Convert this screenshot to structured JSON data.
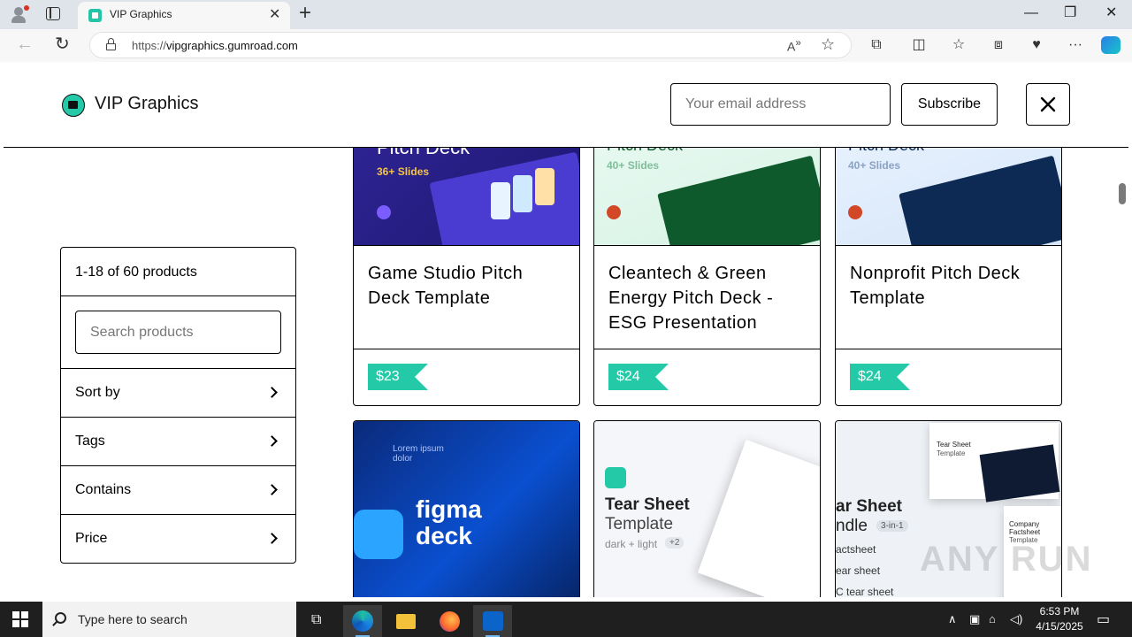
{
  "browser": {
    "tab_title": "VIP Graphics",
    "url_prefix": "https://",
    "url_host": "vipgraphics.gumroad.com"
  },
  "header": {
    "site_title": "VIP Graphics",
    "email_placeholder": "Your email address",
    "subscribe_label": "Subscribe"
  },
  "filters": {
    "count": "1-18 of 60 products",
    "search_placeholder": "Search products",
    "rows": [
      "Sort by",
      "Tags",
      "Contains",
      "Price"
    ]
  },
  "products": [
    {
      "title": "Game Studio Pitch Deck Template",
      "price": "$23",
      "thumb_heading": "Pitch Deck",
      "thumb_sub": "36+ Slides"
    },
    {
      "title": "Cleantech & Green Energy Pitch Deck - ESG Presentation",
      "price": "$24",
      "thumb_heading": "Pitch Deck",
      "thumb_sub": "40+ Slides"
    },
    {
      "title": "Nonprofit Pitch Deck Template",
      "price": "$24",
      "thumb_heading": "Pitch Deck",
      "thumb_sub": "40+ Slides"
    }
  ],
  "thumbs_row2": {
    "figma_line1": "figma",
    "figma_line2": "deck",
    "figma_lorem": "Lorem ipsum dolor",
    "tear_title1": "Tear Sheet",
    "tear_title2": "Template",
    "tear_sub": "dark + light",
    "tear_badge": "+2",
    "bundle_title1": "ar Sheet",
    "bundle_title2": "ndle",
    "bundle_badge": "3-in-1",
    "bundle_item1": "actsheet",
    "bundle_item2": "ear sheet",
    "bundle_item3": "C tear sheet",
    "bundle_card1_a": "Tear Sheet",
    "bundle_card1_b": "Template",
    "bundle_card2_a": "Company",
    "bundle_card2_b": "Factsheet",
    "bundle_card2_c": "Template"
  },
  "watermark": "ANY RUN",
  "taskbar": {
    "search_placeholder": "Type here to search",
    "time": "6:53 PM",
    "date": "4/15/2025"
  },
  "colors": {
    "accent": "#24c9a8",
    "deck_purple": "#2a1f86",
    "deck_green": "#0f5a2c",
    "deck_navy": "#0d2a55",
    "figma_blue": "#0a3fb0"
  }
}
